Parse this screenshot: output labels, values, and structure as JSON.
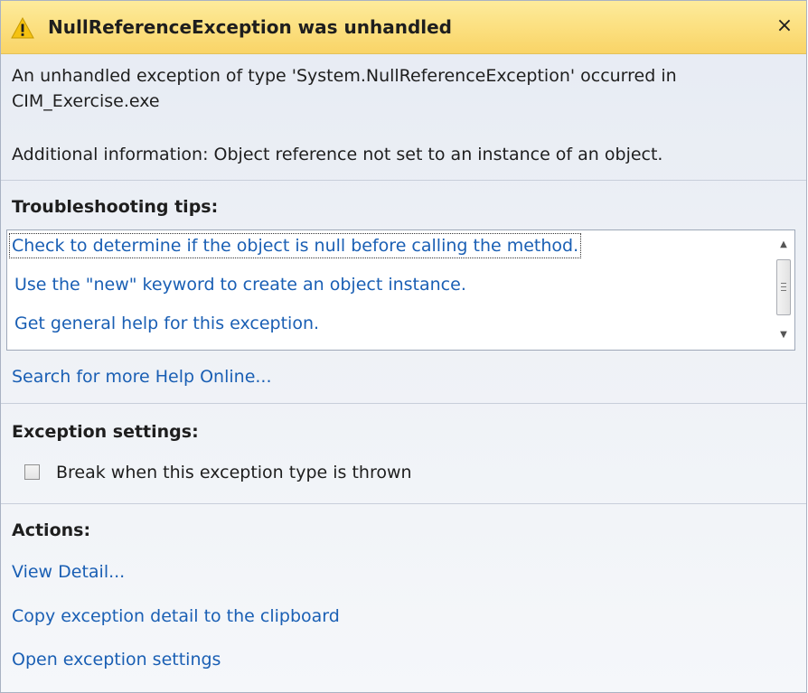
{
  "title_bar": {
    "icon": "warning-icon",
    "title": "NullReferenceException was unhandled",
    "close_label": "×"
  },
  "message": {
    "line1": "An unhandled exception of type 'System.NullReferenceException' occurred in",
    "line2": "CIM_Exercise.exe",
    "additional": "Additional information: Object reference not set to an instance of an object."
  },
  "troubleshooting": {
    "heading": "Troubleshooting tips:",
    "tips": [
      "Check to determine if the object is null before calling the method.",
      "Use the \"new\" keyword to create an object instance.",
      "Get general help for this exception."
    ],
    "search_link": "Search for more Help Online..."
  },
  "exception_settings": {
    "heading": "Exception settings:",
    "checkbox_label": "Break when this exception type is thrown",
    "checked": false
  },
  "actions": {
    "heading": "Actions:",
    "items": [
      "View Detail...",
      "Copy exception detail to the clipboard",
      "Open exception settings"
    ]
  },
  "colors": {
    "title_bar": "#fce183",
    "link": "#1a5fb4",
    "background": "#eef1f6"
  }
}
